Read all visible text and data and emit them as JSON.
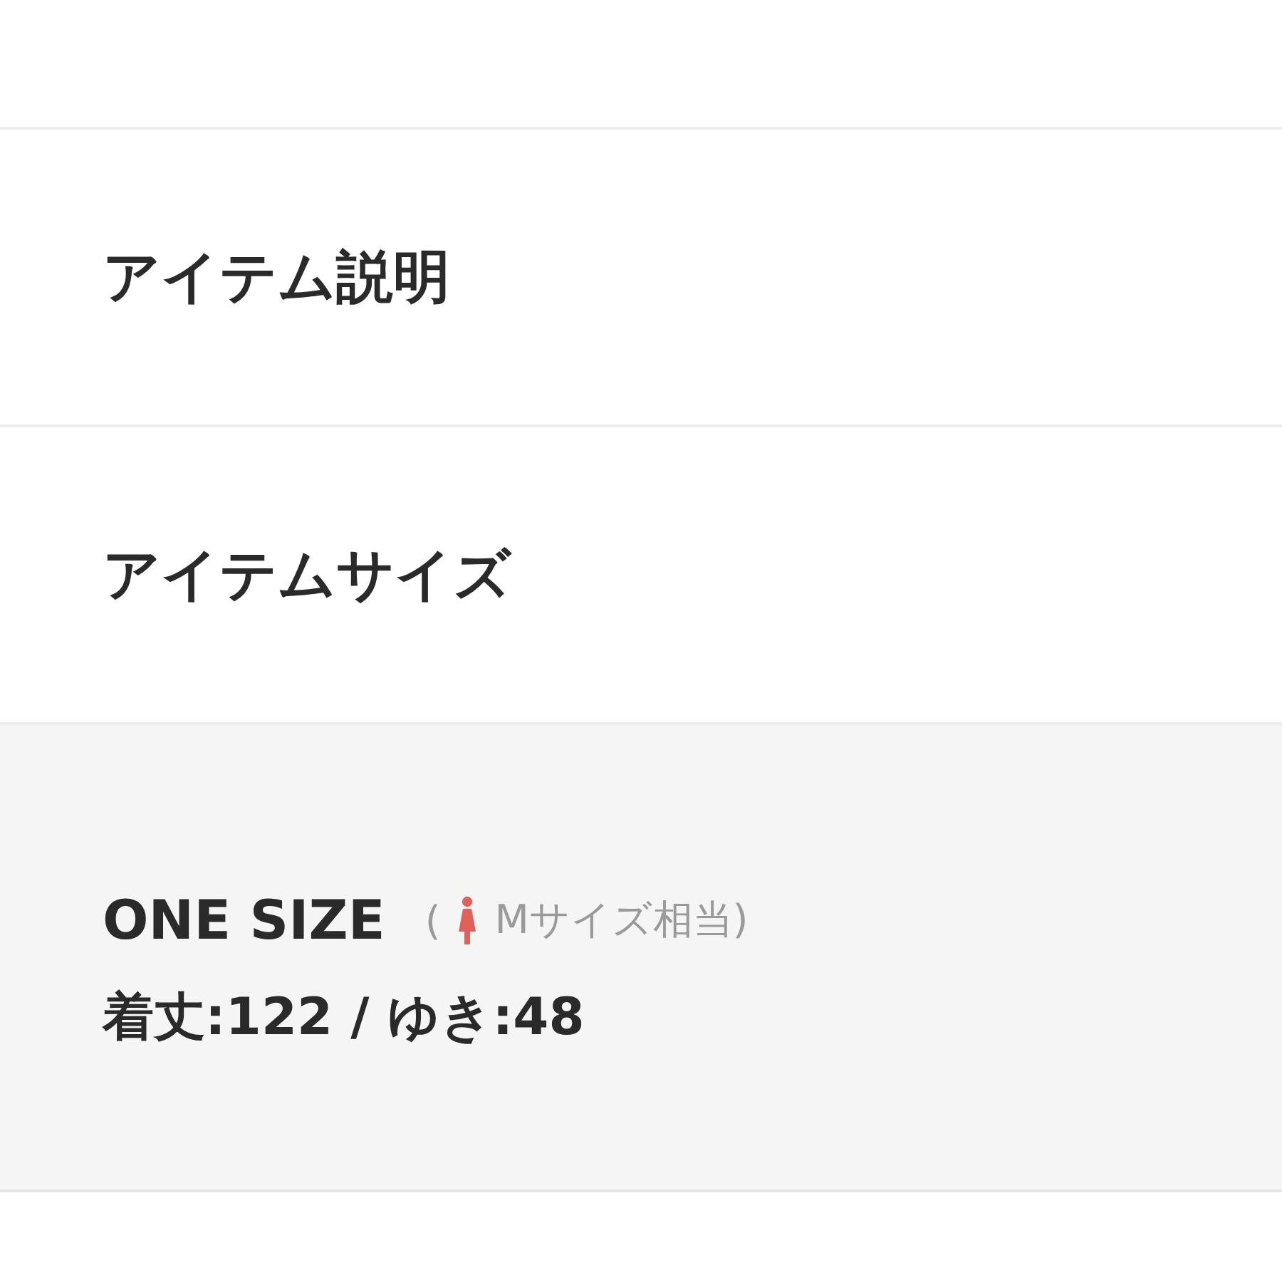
{
  "sections": [
    {
      "title": "アイテム説明"
    },
    {
      "title": "アイテムサイズ"
    }
  ],
  "size": {
    "name": "ONE SIZE",
    "open_paren": "(",
    "equivalent": "Mサイズ相当)",
    "measurements": "着丈:122 / ゆき:48"
  }
}
